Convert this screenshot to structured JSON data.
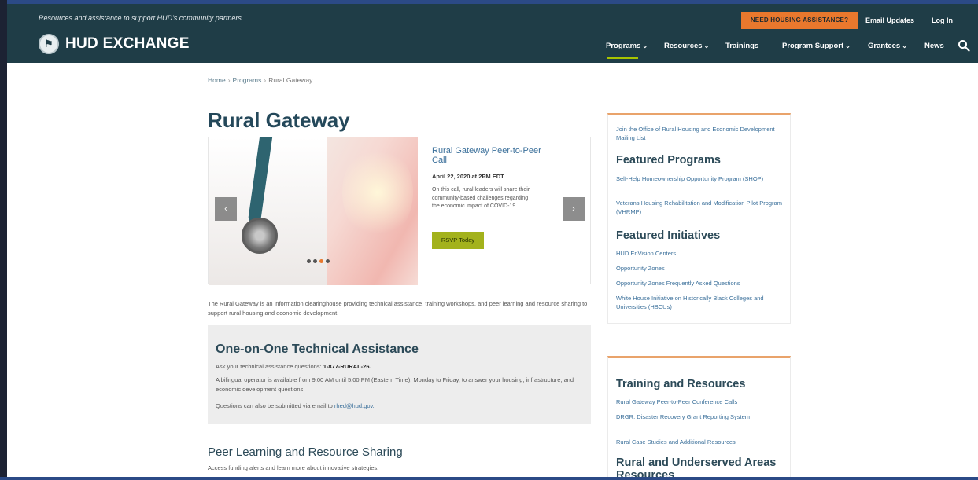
{
  "header": {
    "tagline": "Resources and assistance to support HUD's community partners",
    "cta_label": "NEED HOUSING ASSISTANCE?",
    "email_updates": "Email Updates",
    "login": "Log In",
    "brand_name": "HUD EXCHANGE",
    "nav": [
      {
        "label": "Programs",
        "has_menu": true,
        "active": true
      },
      {
        "label": "Resources",
        "has_menu": true
      },
      {
        "label": "Trainings",
        "has_menu": false
      },
      {
        "label": "Program Support",
        "has_menu": true
      },
      {
        "label": "Grantees",
        "has_menu": true
      },
      {
        "label": "News",
        "has_menu": false
      }
    ],
    "chevron": "⌄",
    "search_icon": "search-icon"
  },
  "breadcrumb": {
    "items": [
      "Home",
      "Programs",
      "Rural Gateway"
    ],
    "separator": "›"
  },
  "page_title": "Rural Gateway",
  "hero": {
    "prev_arrow": "‹",
    "next_arrow": "›",
    "slide_title": "Rural Gateway Peer-to-Peer Call",
    "slide_date": "April 22, 2020 at 2PM EDT",
    "slide_text": "On this call, rural leaders will share their community-based challenges regarding the economic impact of COVID-19.",
    "button_label": "RSVP Today",
    "dot_count": 4,
    "active_dot": 2
  },
  "intro": "The Rural Gateway is an information clearinghouse providing technical assistance, training workshops, and peer learning and resource sharing to support rural housing and economic development.",
  "technical_assistance": {
    "title": "One-on-One Technical Assistance",
    "line1_prefix": "Ask your technical assistance questions: ",
    "phone": "1-877-RURAL-26.",
    "line2": "A bilingual operator is available from 9:00 AM until 5:00 PM (Eastern Time), Monday to Friday, to answer your housing, infrastructure, and economic development questions.",
    "line3_prefix": "Questions can also be submitted via email to ",
    "email": "rhed@hud.gov."
  },
  "peer_learning": {
    "title": "Peer Learning and Resource Sharing",
    "text": "Access funding alerts and learn more about innovative strategies."
  },
  "sidebar": {
    "mailing_list_link": "Join the Office of Rural Housing and Economic Development Mailing List",
    "featured_programs": {
      "heading": "Featured Programs",
      "links": [
        "Self-Help Homeownership Opportunity Program (SHOP)",
        "Veterans Housing Rehabilitation and Modification Pilot Program (VHRMP)"
      ]
    },
    "featured_initiatives": {
      "heading": "Featured Initiatives",
      "links": [
        "HUD EnVision Centers",
        "Opportunity Zones",
        "Opportunity Zones Frequently Asked Questions",
        "White House Initiative on Historically Black Colleges and Universities (HBCUs)"
      ]
    },
    "training_resources": {
      "heading": "Training and Resources",
      "links": [
        "Rural Gateway Peer-to-Peer Conference Calls",
        "DRGR: Disaster Recovery Grant Reporting System",
        "Rural Case Studies and Additional Resources"
      ]
    },
    "underserved": {
      "heading": "Rural and Underserved Areas Resources"
    }
  },
  "colors": {
    "header_bg": "#1f3d47",
    "cta_orange": "#e9782d",
    "nav_active_underline": "#a8c400",
    "title_blue": "#24485a",
    "link_blue": "#3a6f9a",
    "rsvp_green": "#a3b21c",
    "card_top_border": "#e9a36b"
  }
}
